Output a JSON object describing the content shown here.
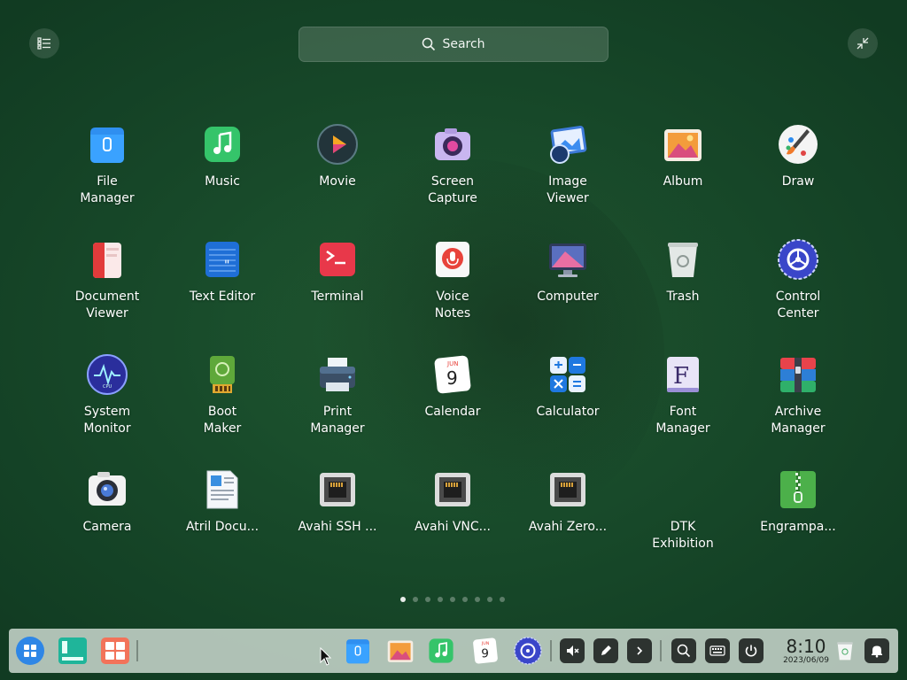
{
  "search": {
    "placeholder": "Search"
  },
  "apps": [
    {
      "label": "File\nManager",
      "icon": "file-manager-icon"
    },
    {
      "label": "Music",
      "icon": "music-icon"
    },
    {
      "label": "Movie",
      "icon": "movie-icon"
    },
    {
      "label": "Screen\nCapture",
      "icon": "screen-capture-icon"
    },
    {
      "label": "Image\nViewer",
      "icon": "image-viewer-icon"
    },
    {
      "label": "Album",
      "icon": "album-icon"
    },
    {
      "label": "Draw",
      "icon": "draw-icon"
    },
    {
      "label": "Document\nViewer",
      "icon": "document-viewer-icon"
    },
    {
      "label": "Text Editor",
      "icon": "text-editor-icon"
    },
    {
      "label": "Terminal",
      "icon": "terminal-icon"
    },
    {
      "label": "Voice\nNotes",
      "icon": "voice-notes-icon"
    },
    {
      "label": "Computer",
      "icon": "computer-icon"
    },
    {
      "label": "Trash",
      "icon": "trash-icon"
    },
    {
      "label": "Control\nCenter",
      "icon": "control-center-icon"
    },
    {
      "label": "System\nMonitor",
      "icon": "system-monitor-icon"
    },
    {
      "label": "Boot\nMaker",
      "icon": "boot-maker-icon"
    },
    {
      "label": "Print\nManager",
      "icon": "print-manager-icon"
    },
    {
      "label": "Calendar",
      "icon": "calendar-icon"
    },
    {
      "label": "Calculator",
      "icon": "calculator-icon"
    },
    {
      "label": "Font\nManager",
      "icon": "font-manager-icon"
    },
    {
      "label": "Archive\nManager",
      "icon": "archive-manager-icon"
    },
    {
      "label": "Camera",
      "icon": "camera-icon"
    },
    {
      "label": "Atril Docu...",
      "icon": "atril-document-icon"
    },
    {
      "label": "Avahi SSH ...",
      "icon": "avahi-ssh-icon"
    },
    {
      "label": "Avahi VNC...",
      "icon": "avahi-vnc-icon"
    },
    {
      "label": "Avahi Zero...",
      "icon": "avahi-zeroconf-icon"
    },
    {
      "label": "DTK\nExhibition",
      "icon": "dtk-exhibition-icon"
    },
    {
      "label": "Engrampa...",
      "icon": "engrampa-icon"
    }
  ],
  "pager": {
    "pages": 9,
    "current": 1
  },
  "calendar_icon": {
    "month": "JUN",
    "day": "9"
  },
  "clock": {
    "time": "8:10",
    "date": "2023/06/09"
  },
  "colors": {
    "desktop": "#184a2a",
    "dock": "#d2ded6",
    "accent": "#2e86e6"
  }
}
